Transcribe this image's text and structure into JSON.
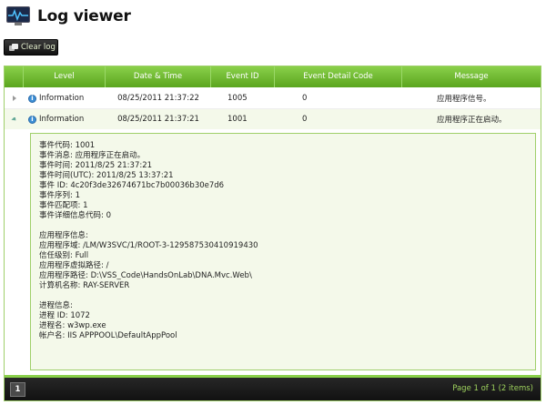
{
  "header": {
    "title": "Log viewer",
    "icon": "monitor-pulse-icon"
  },
  "toolbar": {
    "clear_label": "Clear log"
  },
  "grid": {
    "columns": [
      "Level",
      "Date & Time",
      "Event ID",
      "Event Detail Code",
      "Message"
    ],
    "rows": [
      {
        "level": "Information",
        "datetime": "08/25/2011 21:37:22",
        "event_id": "1005",
        "detail_code": "0",
        "message": "应用程序信号。",
        "expanded": false
      },
      {
        "level": "Information",
        "datetime": "08/25/2011 21:37:21",
        "event_id": "1001",
        "detail_code": "0",
        "message": "应用程序正在启动。",
        "expanded": true
      }
    ],
    "detail_lines": [
      "事件代码: 1001",
      "事件消息: 应用程序正在启动。",
      "事件时间: 2011/8/25 21:37:21",
      "事件时间(UTC): 2011/8/25 13:37:21",
      "事件 ID: 4c20f3de32674671bc7b00036b30e7d6",
      "事件序列: 1",
      "事件匹配项: 1",
      "事件详细信息代码: 0",
      "",
      "应用程序信息:",
      "应用程序域: /LM/W3SVC/1/ROOT-3-129587530410919430",
      "信任级别: Full",
      "应用程序虚拟路径: /",
      "应用程序路径: D:\\VSS_Code\\HandsOnLab\\DNA.Mvc.Web\\",
      "计算机名称: RAY-SERVER",
      "",
      "进程信息:",
      "进程 ID: 1072",
      "进程名: w3wp.exe",
      "帐户名: IIS APPPOOL\\DefaultAppPool"
    ]
  },
  "pager": {
    "current_page": "1",
    "info": "Page 1 of 1 (2 items)"
  },
  "colors": {
    "header_green": "#6ab82c",
    "accent_text": "#9fd35e"
  }
}
